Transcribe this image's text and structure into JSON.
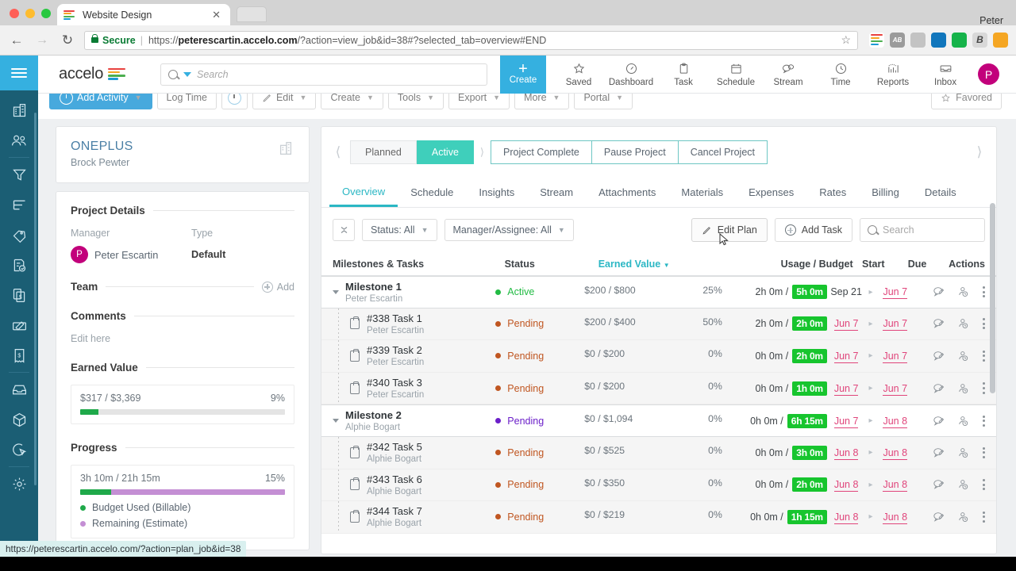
{
  "browser": {
    "tab_title": "Website Design",
    "window_user": "Peter",
    "secure_label": "Secure",
    "url_prefix": "https://",
    "url_domain": "peterescartin.accelo.com",
    "url_rest": "/?action=view_job&id=38#?selected_tab=overview#END",
    "status_url": "https://peterescartin.accelo.com/?action=plan_job&id=38"
  },
  "header": {
    "logo_text": "accelo",
    "search_placeholder": "Search",
    "create_label": "Create",
    "nav": [
      {
        "label": "Saved",
        "icon": "star-icon"
      },
      {
        "label": "Dashboard",
        "icon": "gauge-icon"
      },
      {
        "label": "Task",
        "icon": "clipboard-icon"
      },
      {
        "label": "Schedule",
        "icon": "calendar-icon"
      },
      {
        "label": "Stream",
        "icon": "chat-icon"
      },
      {
        "label": "Time",
        "icon": "clock-icon"
      },
      {
        "label": "Reports",
        "icon": "bar-chart-icon"
      },
      {
        "label": "Inbox",
        "icon": "inbox-icon"
      }
    ],
    "avatar_initial": "P"
  },
  "toolbar": {
    "add_activity": "Add Activity",
    "log_time": "Log Time",
    "edit": "Edit",
    "create": "Create",
    "tools": "Tools",
    "export": "Export",
    "more": "More",
    "portal": "Portal",
    "favored": "Favored"
  },
  "sidebar_rail": {
    "items": [
      {
        "name": "company-icon"
      },
      {
        "name": "contacts-icon"
      },
      {
        "name": "filter-icon"
      },
      {
        "name": "projects-icon"
      },
      {
        "name": "tags-icon"
      },
      {
        "name": "requests-icon"
      },
      {
        "name": "quotes-icon"
      },
      {
        "name": "invoice-pen-icon"
      },
      {
        "name": "receipt-icon"
      },
      {
        "name": "inbox-down-icon"
      },
      {
        "name": "box-icon"
      },
      {
        "name": "cursor-target-icon"
      },
      {
        "name": "settings-gear-icon"
      }
    ]
  },
  "company": {
    "name": "ONEPLUS",
    "contact": "Brock Pewter"
  },
  "project_details": {
    "heading": "Project Details",
    "manager_label": "Manager",
    "manager_name": "Peter Escartin",
    "manager_initial": "P",
    "type_label": "Type",
    "type_value": "Default",
    "team_heading": "Team",
    "team_add": "Add",
    "comments_heading": "Comments",
    "comments_text": "Edit here",
    "earned_value_heading": "Earned Value",
    "earned_value_text": "$317 / $3,369",
    "earned_value_pct": "9%",
    "earned_value_pct_num": 9,
    "progress_heading": "Progress",
    "progress_text": "3h 10m / 21h 15m",
    "progress_pct": "15%",
    "progress_used_num": 15,
    "progress_remaining_num": 85,
    "legend": [
      {
        "label": "Budget Used (Billable)",
        "color": "#1fa94a"
      },
      {
        "label": "Remaining (Estimate)",
        "color": "#c48fd4"
      }
    ]
  },
  "status_bar": {
    "planned": "Planned",
    "active": "Active",
    "actions": [
      "Project Complete",
      "Pause Project",
      "Cancel Project"
    ]
  },
  "tabs": [
    {
      "label": "Overview",
      "active": true
    },
    {
      "label": "Schedule",
      "active": false
    },
    {
      "label": "Insights",
      "active": false
    },
    {
      "label": "Stream",
      "active": false
    },
    {
      "label": "Attachments",
      "active": false
    },
    {
      "label": "Materials",
      "active": false
    },
    {
      "label": "Expenses",
      "active": false
    },
    {
      "label": "Rates",
      "active": false
    },
    {
      "label": "Billing",
      "active": false
    },
    {
      "label": "Details",
      "active": false
    }
  ],
  "filters": {
    "status": "Status: All",
    "assignee": "Manager/Assignee: All",
    "edit_plan": "Edit Plan",
    "add_task": "Add Task",
    "search_placeholder": "Search"
  },
  "table": {
    "columns": {
      "name": "Milestones & Tasks",
      "status": "Status",
      "earned_value": "Earned Value",
      "usage": "Usage / Budget",
      "start": "Start",
      "due": "Due",
      "actions": "Actions"
    },
    "rows": [
      {
        "type": "milestone",
        "name": "Milestone 1",
        "assignee": "Peter Escartin",
        "status": "Active",
        "status_color": "#22bb44",
        "ev": "$200 / $800",
        "pct": "25%",
        "pct_num": 25,
        "used": "2h 0m",
        "budget": "5h 0m",
        "start": "Sep 21",
        "due": "Jun 7",
        "due_link": true,
        "start_link": false
      },
      {
        "type": "task",
        "name": "#338 Task 1",
        "assignee": "Peter Escartin",
        "status": "Pending",
        "status_color": "#c05621",
        "ev": "$200 / $400",
        "pct": "50%",
        "pct_num": 50,
        "used": "2h 0m",
        "budget": "2h 0m",
        "start": "Jun 7",
        "due": "Jun 7",
        "due_link": true,
        "start_link": true
      },
      {
        "type": "task",
        "name": "#339 Task 2",
        "assignee": "Peter Escartin",
        "status": "Pending",
        "status_color": "#c05621",
        "ev": "$0 / $200",
        "pct": "0%",
        "pct_num": 0,
        "used": "0h 0m",
        "budget": "2h 0m",
        "start": "Jun 7",
        "due": "Jun 7",
        "due_link": true,
        "start_link": true
      },
      {
        "type": "task",
        "name": "#340 Task 3",
        "assignee": "Peter Escartin",
        "status": "Pending",
        "status_color": "#c05621",
        "ev": "$0 / $200",
        "pct": "0%",
        "pct_num": 0,
        "used": "0h 0m",
        "budget": "1h 0m",
        "start": "Jun 7",
        "due": "Jun 7",
        "due_link": true,
        "start_link": true
      },
      {
        "type": "milestone",
        "name": "Milestone 2",
        "assignee": "Alphie Bogart",
        "status": "Pending",
        "status_color": "#6b1fc9",
        "ev": "$0 / $1,094",
        "pct": "0%",
        "pct_num": 0,
        "used": "0h 0m",
        "budget": "6h 15m",
        "start": "Jun 7",
        "due": "Jun 8",
        "due_link": true,
        "start_link": true
      },
      {
        "type": "task",
        "name": "#342 Task 5",
        "assignee": "Alphie Bogart",
        "status": "Pending",
        "status_color": "#c05621",
        "ev": "$0 / $525",
        "pct": "0%",
        "pct_num": 0,
        "used": "0h 0m",
        "budget": "3h 0m",
        "start": "Jun 8",
        "due": "Jun 8",
        "due_link": true,
        "start_link": true
      },
      {
        "type": "task",
        "name": "#343 Task 6",
        "assignee": "Alphie Bogart",
        "status": "Pending",
        "status_color": "#c05621",
        "ev": "$0 / $350",
        "pct": "0%",
        "pct_num": 0,
        "used": "0h 0m",
        "budget": "2h 0m",
        "start": "Jun 8",
        "due": "Jun 8",
        "due_link": true,
        "start_link": true
      },
      {
        "type": "task",
        "name": "#344 Task 7",
        "assignee": "Alphie Bogart",
        "status": "Pending",
        "status_color": "#c05621",
        "ev": "$0 / $219",
        "pct": "0%",
        "pct_num": 0,
        "used": "0h 0m",
        "budget": "1h 15m",
        "start": "Jun 8",
        "due": "Jun 8",
        "due_link": true,
        "start_link": true
      }
    ]
  },
  "colors": {
    "teal": "#3fcfbb",
    "tab_accent": "#2bb7c4",
    "blue": "#35b0e0",
    "rail": "#1b5e74",
    "magenta": "#c2007b",
    "green_badge": "#17c52e",
    "pink_link": "#e0457b"
  }
}
